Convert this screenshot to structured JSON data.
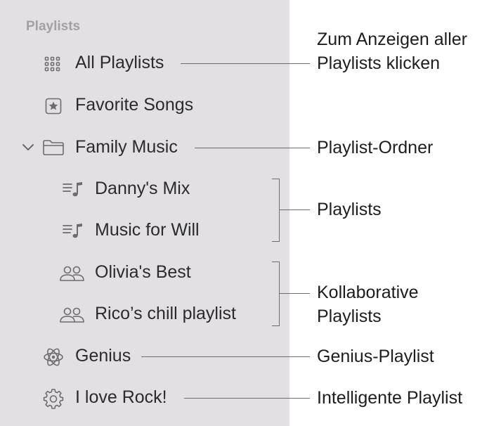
{
  "sidebar": {
    "section_title": "Playlists",
    "items": {
      "all_playlists": {
        "label": "All Playlists",
        "icon": "grid-icon"
      },
      "favorite_songs": {
        "label": "Favorite Songs",
        "icon": "star-square-icon"
      },
      "family_music": {
        "label": "Family Music",
        "icon": "folder-icon",
        "expanded": true
      },
      "dannys_mix": {
        "label": "Danny's Mix",
        "icon": "playlist-icon"
      },
      "music_for_will": {
        "label": "Music for Will",
        "icon": "playlist-icon"
      },
      "olivias_best": {
        "label": "Olivia's Best",
        "icon": "people-icon"
      },
      "ricos_chill": {
        "label": "Rico’s chill playlist",
        "icon": "people-icon"
      },
      "genius": {
        "label": "Genius",
        "icon": "atom-icon"
      },
      "i_love_rock": {
        "label": "I love Rock!",
        "icon": "gear-icon"
      }
    }
  },
  "callouts": {
    "all_playlists_line1": "Zum Anzeigen aller",
    "all_playlists_line2": "Playlists klicken",
    "folder": "Playlist-Ordner",
    "playlists": "Playlists",
    "collab_line1": "Kollaborative",
    "collab_line2": "Playlists",
    "genius": "Genius-Playlist",
    "smart": "Intelligente Playlist"
  },
  "colors": {
    "sidebar_bg": "#e2e0e2",
    "section_title": "#a2a0a2",
    "icon": "#6d6b6e",
    "callout_line": "#6e6e6e"
  }
}
